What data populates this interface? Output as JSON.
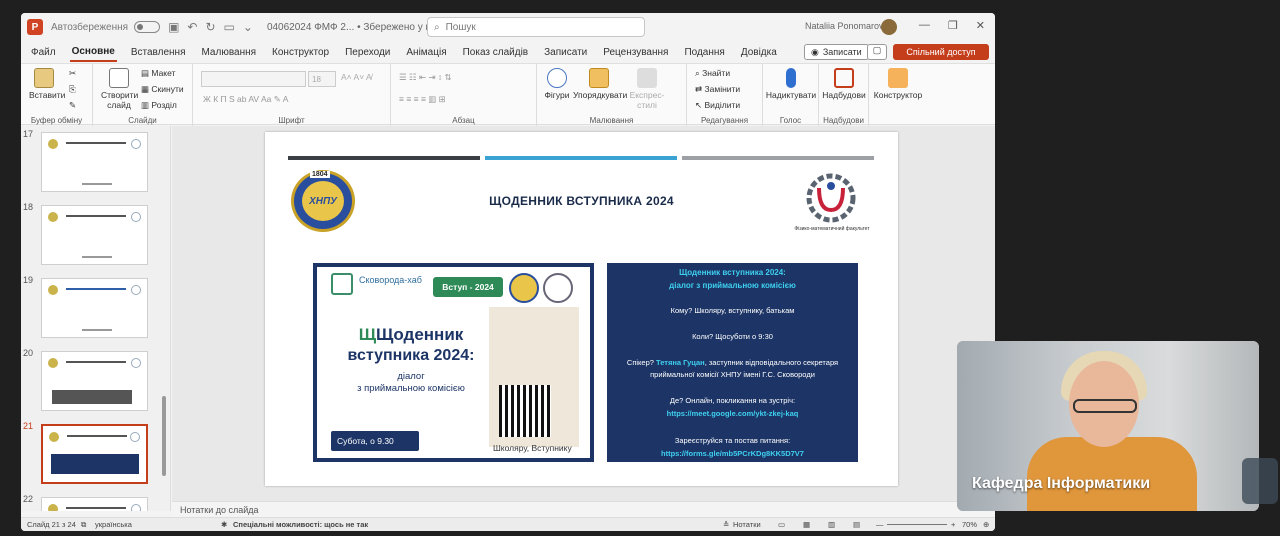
{
  "titlebar": {
    "autosave": "Автозбереження",
    "doc_name": "04062024 ФМФ 2... • Збережено у цей ПК",
    "search_placeholder": "Пошук",
    "user": "Nataliia Ponomarova"
  },
  "tabs": [
    "Файл",
    "Основне",
    "Вставлення",
    "Малювання",
    "Конструктор",
    "Переходи",
    "Анімація",
    "Показ слайдів",
    "Записати",
    "Рецензування",
    "Подання",
    "Довідка"
  ],
  "actions": {
    "record": "Записати",
    "share": "Спільний доступ"
  },
  "ribbon": {
    "paste": "Вставити",
    "clipboard": "Буфер обміну",
    "new_slide": "Створити слайд",
    "layout": "Макет",
    "reset": "Скинути",
    "section": "Розділ",
    "slides": "Слайди",
    "font_size": "18",
    "font": "Шрифт",
    "paragraph": "Абзац",
    "shapes": "Фігури",
    "arrange": "Упорядкувати",
    "quick_styles": "Експрес-стилі",
    "drawing": "Малювання",
    "find": "Знайти",
    "replace": "Замінити",
    "select": "Виділити",
    "editing": "Редагування",
    "dictate": "Надиктувати",
    "voice": "Голос",
    "addins": "Надбудови",
    "addins_group": "Надбудови",
    "designer": "Конструктор"
  },
  "thumbs": [
    {
      "num": "17"
    },
    {
      "num": "18"
    },
    {
      "num": "19"
    },
    {
      "num": "20"
    },
    {
      "num": "21"
    },
    {
      "num": "22"
    }
  ],
  "slide": {
    "title": "ЩОДЕННИК ВСТУПНИКА 2024",
    "logo_left_year": "1804",
    "logo_left_text": "ХНПУ",
    "logo_right_caption": "Фізико-математичний факультет",
    "poster": {
      "brand": "Сковорода-хаб",
      "badge": "Вступ - 2024",
      "headline_1": "Щоденник",
      "headline_2": "вступника 2024:",
      "sub_1": "діалог",
      "sub_2": "з приймальною комісією",
      "day": "Субота, о 9.30",
      "audience": "Школяру, Вступнику"
    },
    "info": {
      "title_1": "Щоденник вступника 2024:",
      "title_2": "діалог з приймальною комісією",
      "who": "Кому? Школяру, вступнику, батькам",
      "when": "Коли? Щосуботи о 9:30",
      "speaker_prefix": "Спікер?",
      "speaker_name": "Тетяна Гуцан",
      "speaker_rest_1": ", заступник відповідального секретаря",
      "speaker_rest_2": "приймальної комісії ХНПУ імені Г.С. Сковороди",
      "where": "Де? Онлайн, покликання на зустріч:",
      "meet_link": "https://meet.google.com/ykt-zkej-kaq",
      "register": "Зареєструйся та постав питання:",
      "form_link": "https://forms.gle/mb5PCrKDg8KK5D7V7"
    }
  },
  "notes_placeholder": "Нотатки до слайда",
  "status": {
    "slide_count": "Слайд 21 з 24",
    "language": "українська",
    "accessibility": "Спеціальні можливості: щось не так",
    "notes": "Нотатки",
    "zoom": "70%"
  },
  "video": {
    "label": "Кафедра Інформатики"
  }
}
